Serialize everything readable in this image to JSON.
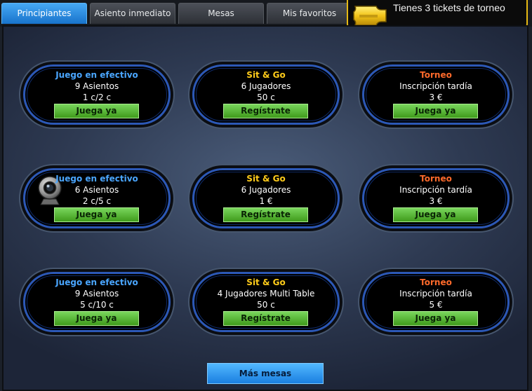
{
  "tabs": [
    {
      "label": "Principiantes",
      "active": true
    },
    {
      "label": "Asiento inmediato",
      "active": false
    },
    {
      "label": "Mesas",
      "active": false
    },
    {
      "label": "Mis favoritos",
      "active": false
    }
  ],
  "ticket_notice": {
    "text": "Tienes 3 tickets de torneo",
    "icon": "ticket-icon"
  },
  "colors": {
    "accent_blue": "#1873cb",
    "cash_title": "#4aa6ff",
    "sng_title": "#ffcc1a",
    "tournament_title": "#ff6a2b",
    "action_green": "#3f9b1b",
    "ticket_gold": "#e6b914"
  },
  "tables": [
    {
      "title": "Juego en efectivo",
      "line1": "9 Asientos",
      "line2": "1 c/2 c",
      "button": "Juega ya"
    },
    {
      "title": "Sit & Go",
      "line1": "6 Jugadores",
      "line2": "50 c",
      "button": "Regístrate"
    },
    {
      "title": "Torneo",
      "line1": "Inscripción tardía",
      "line2": "3 €",
      "button": "Juega ya"
    },
    {
      "title": "Juego en efectivo",
      "line1": "6 Asientos",
      "line2": "2 c/5 c",
      "button": "Juega ya",
      "icon": "webcam-icon"
    },
    {
      "title": "Sit & Go",
      "line1": "6 Jugadores",
      "line2": "1 €",
      "button": "Regístrate"
    },
    {
      "title": "Torneo",
      "line1": "Inscripción tardía",
      "line2": "3 €",
      "button": "Juega ya"
    },
    {
      "title": "Juego en efectivo",
      "line1": "9 Asientos",
      "line2": "5 c/10 c",
      "button": "Juega ya"
    },
    {
      "title": "Sit & Go",
      "line1": "4 Jugadores Multi Table",
      "line2": "50 c",
      "button": "Regístrate"
    },
    {
      "title": "Torneo",
      "line1": "Inscripción tardía",
      "line2": "5 €",
      "button": "Juega ya"
    }
  ],
  "more_button": "Más mesas"
}
